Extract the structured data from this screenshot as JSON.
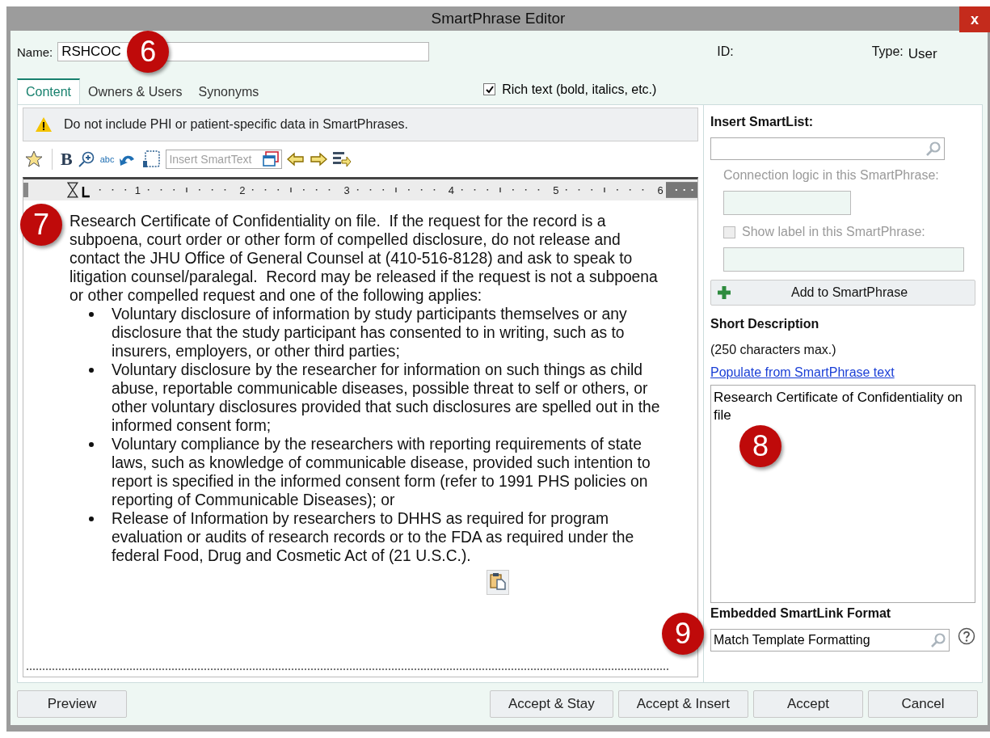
{
  "window": {
    "title": "SmartPhrase Editor",
    "close": "x"
  },
  "header": {
    "name_label": "Name:",
    "name_value": "RSHCOC",
    "callout": "6",
    "id_label": "ID:",
    "type_label": "Type:",
    "type_value": "User"
  },
  "tabs": [
    {
      "label": "Content",
      "selected": true
    },
    {
      "label": "Owners & Users",
      "selected": false
    },
    {
      "label": "Synonyms",
      "selected": false
    }
  ],
  "rich_text": {
    "label": "Rich text (bold, italics, etc.)",
    "checked": true
  },
  "warning": {
    "text": "Do not include PHI or patient-specific data in SmartPhrases."
  },
  "toolbar": {
    "bold": "B",
    "spell": "abc",
    "smarttext_placeholder": "Insert SmartText"
  },
  "ruler": {
    "labels": [
      "1",
      "2",
      "3",
      "4",
      "5",
      "6"
    ]
  },
  "editor": {
    "callout": "7",
    "blocks": [
      {
        "kind": "paragraph",
        "text": "Research Certificate of Confidentiality on file.  If the request for the record is a subpoena, court order or other form of compelled disclosure, do not release and contact the JHU Office of General Counsel at (410-516-8128) and ask to speak to litigation counsel/paralegal.  Record may be released if the request is not a subpoena or other compelled request and one of the following applies:"
      },
      {
        "kind": "bullet",
        "text": "Voluntary disclosure of information by study participants themselves or any disclosure that the study participant has consented to in writing, such as to insurers, employers, or other third parties;"
      },
      {
        "kind": "bullet",
        "text": "Voluntary disclosure by the researcher for information on such things as child abuse, reportable communicable diseases, possible threat to self or others, or other voluntary disclosures provided that such disclosures are spelled out in the informed consent form;"
      },
      {
        "kind": "bullet",
        "text": "Voluntary compliance by the researchers with reporting requirements of state laws, such as knowledge of communicable disease, provided such intention to report is specified in the informed consent form (refer to 1991 PHS policies on reporting of Communicable Diseases); or"
      },
      {
        "kind": "bullet",
        "text": "Release of Information by researchers to DHHS as required for program evaluation or audits of research records or to the FDA as required under the federal Food, Drug and Cosmetic Act of (21 U.S.C.)."
      }
    ]
  },
  "smartlist": {
    "title": "Insert SmartList:",
    "connection_label": "Connection logic in this SmartPhrase:",
    "show_label": {
      "label": "Show label in this SmartPhrase:",
      "checked": false,
      "disabled": true
    },
    "add_button": "Add to SmartPhrase"
  },
  "short_description": {
    "title": "Short Description",
    "hint": "(250 characters max.)",
    "link": "Populate from SmartPhrase text",
    "value": "Research Certificate of Confidentiality on file",
    "callout": "8"
  },
  "smartlink": {
    "title": "Embedded SmartLink Format",
    "value": "Match Template Formatting",
    "callout": "9"
  },
  "buttons": [
    {
      "label": "Preview",
      "kind": "left"
    },
    {
      "label": "Accept & Stay",
      "kind": "right"
    },
    {
      "label": "Accept & Insert",
      "kind": "right"
    },
    {
      "label": "Accept",
      "kind": "right"
    },
    {
      "label": "Cancel",
      "kind": "right"
    }
  ]
}
